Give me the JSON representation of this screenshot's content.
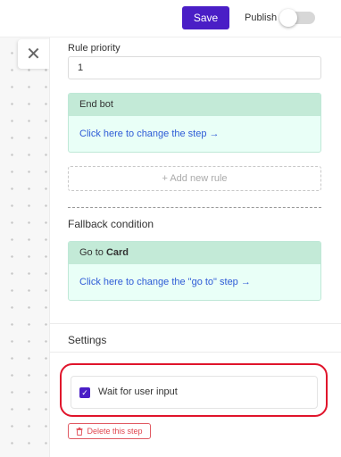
{
  "header": {
    "save_label": "Save",
    "publish_label": "Publish",
    "publish_enabled": false
  },
  "close_icon_glyph": "✕",
  "rule": {
    "priority_label": "Rule priority",
    "priority_value": "1",
    "target_card": {
      "title": "End bot",
      "link": "Click here to change the step →"
    },
    "add_rule_label": "+ Add new rule"
  },
  "fallback": {
    "title": "Fallback condition",
    "card_prefix": "Go to ",
    "card_name": "Card",
    "link": "Click here to change the \"go to\" step →"
  },
  "settings": {
    "title": "Settings",
    "wait_for_input_label": "Wait for user input",
    "wait_for_input_checked": true,
    "check_glyph": "✓",
    "delete_label": "Delete this step"
  },
  "colors": {
    "accent": "#4a1ec6",
    "card_bg": "#e9fff7",
    "card_header": "#c3ead7",
    "link": "#2e5bd6",
    "highlight": "#e0142b",
    "danger": "#e0464f"
  },
  "icons": {
    "close": "close-icon",
    "trash": "trash-icon",
    "check": "check-icon"
  }
}
